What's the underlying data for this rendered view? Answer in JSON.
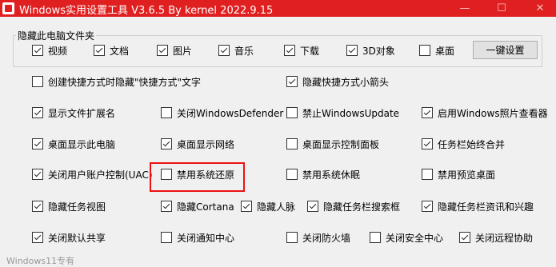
{
  "window": {
    "title": "Windows实用设置工具 V3.6.5 By kernel 2022.9.15",
    "controls": {
      "minimize": "—",
      "maximize": "☐",
      "close": "✕"
    }
  },
  "hide_folders": {
    "title": "隐藏此电脑文件夹",
    "items": [
      {
        "label": "视频",
        "checked": true
      },
      {
        "label": "文档",
        "checked": true
      },
      {
        "label": "图片",
        "checked": true
      },
      {
        "label": "音乐",
        "checked": true
      },
      {
        "label": "下载",
        "checked": true
      },
      {
        "label": "3D对象",
        "checked": true
      },
      {
        "label": "桌面",
        "checked": false
      }
    ],
    "button_label": "一键设置"
  },
  "options": [
    {
      "label": "创建快捷方式时隐藏\"快捷方式\"文字",
      "checked": false
    },
    {
      "label": "隐藏快捷方式小箭头",
      "checked": true
    },
    {
      "label": "显示文件扩展名",
      "checked": true
    },
    {
      "label": "关闭WindowsDefender",
      "checked": false
    },
    {
      "label": "禁止WindowsUpdate",
      "checked": false
    },
    {
      "label": "启用Windows照片查看器",
      "checked": true
    },
    {
      "label": "桌面显示此电脑",
      "checked": true
    },
    {
      "label": "桌面显示网络",
      "checked": true
    },
    {
      "label": "桌面显示控制面板",
      "checked": false
    },
    {
      "label": "任务栏始终合并",
      "checked": true
    },
    {
      "label": "关闭用户账户控制(UAC)",
      "checked": true
    },
    {
      "label": "禁用系统还原",
      "checked": false
    },
    {
      "label": "禁用系统休眠",
      "checked": false
    },
    {
      "label": "禁用预览桌面",
      "checked": false
    },
    {
      "label": "隐藏任务视图",
      "checked": true
    },
    {
      "label": "隐藏Cortana",
      "checked": true
    },
    {
      "label": "隐藏人脉",
      "checked": true
    },
    {
      "label": "隐藏任务栏搜索框",
      "checked": true
    },
    {
      "label": "隐藏任务栏资讯和兴趣",
      "checked": true
    },
    {
      "label": "关闭默认共享",
      "checked": true
    },
    {
      "label": "关闭通知中心",
      "checked": false
    },
    {
      "label": "关闭防火墙",
      "checked": false
    },
    {
      "label": "关闭安全中心",
      "checked": false
    },
    {
      "label": "关闭远程协助",
      "checked": true
    }
  ],
  "status_text": "Windows11专有",
  "colors": {
    "titlebar": "#e02020",
    "highlight": "#ee1111"
  }
}
